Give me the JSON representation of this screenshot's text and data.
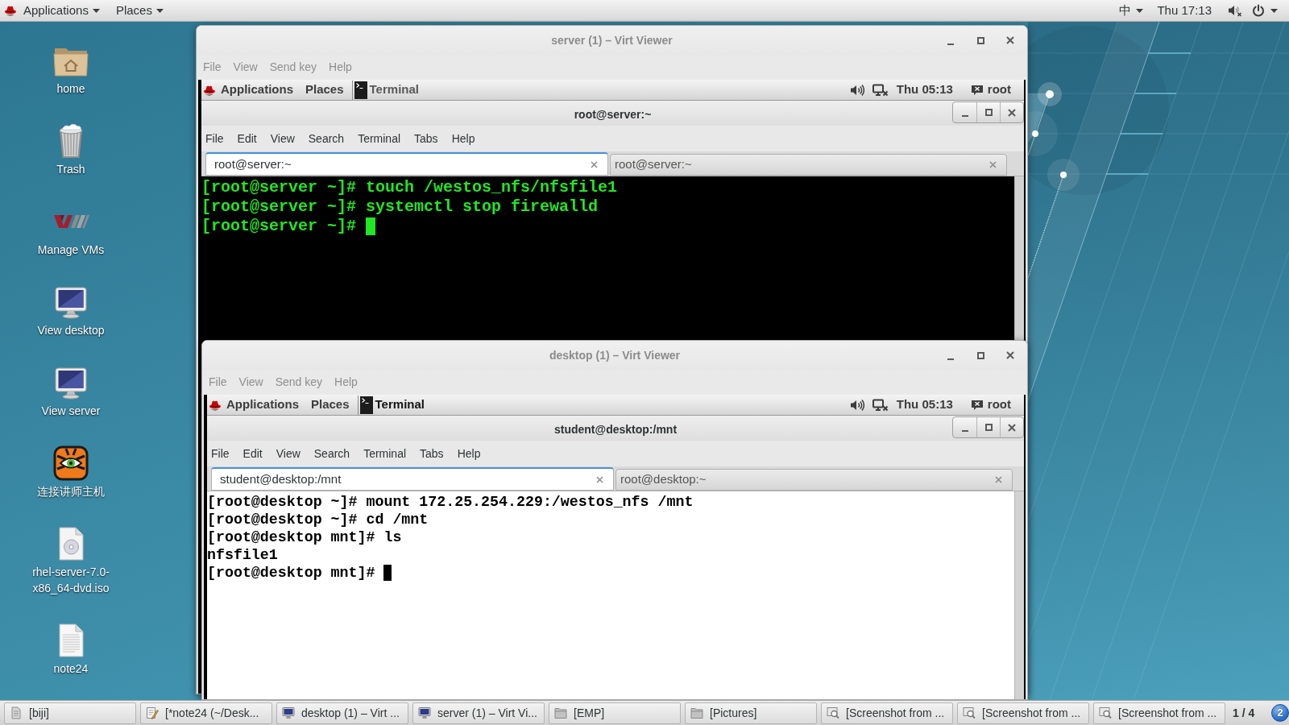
{
  "top_bar": {
    "menus": [
      "Applications",
      "Places"
    ],
    "input_method": "中",
    "clock": "Thu 17:13"
  },
  "desktop_icons": [
    {
      "kind": "folder",
      "label": "home"
    },
    {
      "kind": "trash",
      "label": "Trash"
    },
    {
      "kind": "logo",
      "label": "Manage VMs"
    },
    {
      "kind": "monitor",
      "label": "View desktop"
    },
    {
      "kind": "monitor",
      "label": "View server"
    },
    {
      "kind": "app",
      "label": "连接讲师主机"
    },
    {
      "kind": "disc",
      "label": "rhel-server-7.0-x86_64-dvd.iso"
    },
    {
      "kind": "document",
      "label": "note24"
    }
  ],
  "windows": [
    {
      "title": "server (1) – Virt Viewer",
      "menu": [
        "File",
        "View",
        "Send key",
        "Help"
      ],
      "guest_panel": {
        "menus": [
          "Applications",
          "Places"
        ],
        "task": {
          "label": "Terminal",
          "active": false
        },
        "clock": "Thu 05:13",
        "user": "root"
      },
      "terminal": {
        "title": "root@server:~",
        "menu": [
          "File",
          "Edit",
          "View",
          "Search",
          "Terminal",
          "Tabs",
          "Help"
        ],
        "tabs": [
          {
            "label": "root@server:~",
            "selected": true
          },
          {
            "label": "root@server:~",
            "selected": false
          }
        ],
        "kind": "dark",
        "lines": [
          "[root@server ~]# touch /westos_nfs/nfsfile1",
          "[root@server ~]# systemctl stop firewalld",
          "[root@server ~]#"
        ],
        "cursor": true
      }
    },
    {
      "title": "desktop (1) – Virt Viewer",
      "menu": [
        "File",
        "View",
        "Send key",
        "Help"
      ],
      "guest_panel": {
        "menus": [
          "Applications",
          "Places"
        ],
        "task": {
          "label": "Terminal",
          "active": true
        },
        "clock": "Thu 05:13",
        "user": "root"
      },
      "terminal": {
        "title": "student@desktop:/mnt",
        "menu": [
          "File",
          "Edit",
          "View",
          "Search",
          "Terminal",
          "Tabs",
          "Help"
        ],
        "tabs": [
          {
            "label": "student@desktop:/mnt",
            "selected": true
          },
          {
            "label": "root@desktop:~",
            "selected": false
          }
        ],
        "kind": "light",
        "lines": [
          "[root@desktop ~]# mount 172.25.254.229:/westos_nfs /mnt",
          "[root@desktop ~]# cd /mnt",
          "[root@desktop mnt]# ls",
          "nfsfile1",
          "[root@desktop mnt]#"
        ],
        "cursor": true
      }
    }
  ],
  "taskbar": {
    "items": [
      {
        "kind": "document",
        "label": "[biji]"
      },
      {
        "kind": "editor",
        "label": "[*note24 (~/Desk..."
      },
      {
        "kind": "monitor",
        "label": "desktop (1) – Virt ..."
      },
      {
        "kind": "monitor",
        "label": "server (1) – Virt Vi..."
      },
      {
        "kind": "folder",
        "label": "[EMP]"
      },
      {
        "kind": "folder",
        "label": "[Pictures]"
      },
      {
        "kind": "viewer",
        "label": "[Screenshot from ..."
      },
      {
        "kind": "viewer",
        "label": "[Screenshot from ..."
      },
      {
        "kind": "viewer",
        "label": "[Screenshot from ..."
      }
    ],
    "workspace": "1 / 4",
    "notifications": "2"
  }
}
